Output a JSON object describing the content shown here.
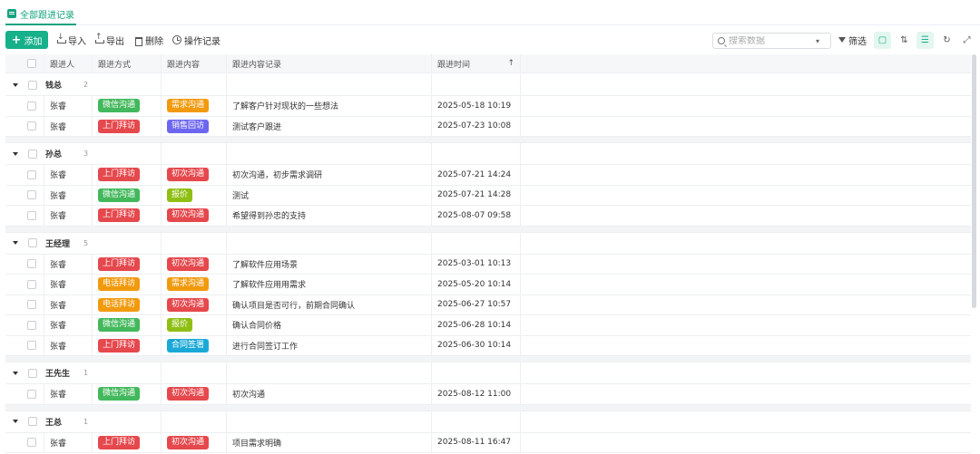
{
  "tab": {
    "label": "全部跟进记录"
  },
  "toolbar": {
    "add_label": "添加",
    "import_label": "导入",
    "export_label": "导出",
    "delete_label": "删除",
    "oplog_label": "操作记录",
    "search_placeholder": "搜索数据",
    "filter_label": "筛选"
  },
  "columns": [
    "跟进人",
    "跟进方式",
    "跟进内容",
    "跟进内容记录",
    "跟进时间"
  ],
  "sort_indicator": "↑",
  "tag_colors": {
    "微信沟通": "#43b85c",
    "上门拜访": "#e5484d",
    "电话拜访": "#f29a0e",
    "需求沟通": "#f29a0e",
    "销售回访": "#6d66f0",
    "初次沟通": "#e5484d",
    "报价": "#8fbf14",
    "合同签署": "#1aa8d6"
  },
  "groups": [
    {
      "name": "钱总",
      "count": "2",
      "rows": [
        {
          "person": "张睿",
          "method": "微信沟通",
          "content": "需求沟通",
          "record": "了解客户针对现状的一些想法",
          "time": "2025-05-18 10:19"
        },
        {
          "person": "张睿",
          "method": "上门拜访",
          "content": "销售回访",
          "record": "测试客户跟进",
          "time": "2025-07-23 10:08"
        }
      ]
    },
    {
      "name": "孙总",
      "count": "3",
      "rows": [
        {
          "person": "张睿",
          "method": "上门拜访",
          "content": "初次沟通",
          "record": "初次沟通，初步需求调研",
          "time": "2025-07-21 14:24"
        },
        {
          "person": "张睿",
          "method": "微信沟通",
          "content": "报价",
          "record": "测试",
          "time": "2025-07-21 14:28"
        },
        {
          "person": "张睿",
          "method": "上门拜访",
          "content": "初次沟通",
          "record": "希望得到孙忠的支持",
          "time": "2025-08-07 09:58"
        }
      ]
    },
    {
      "name": "王经理",
      "count": "5",
      "rows": [
        {
          "person": "张睿",
          "method": "上门拜访",
          "content": "初次沟通",
          "record": "了解软件应用场景",
          "time": "2025-03-01 10:13"
        },
        {
          "person": "张睿",
          "method": "电话拜访",
          "content": "需求沟通",
          "record": "了解软件应用用需求",
          "time": "2025-05-20 10:14"
        },
        {
          "person": "张睿",
          "method": "电话拜访",
          "content": "初次沟通",
          "record": "确认项目是否可行，前期合同确认",
          "time": "2025-06-27 10:57"
        },
        {
          "person": "张睿",
          "method": "微信沟通",
          "content": "报价",
          "record": "确认合同价格",
          "time": "2025-06-28 10:14"
        },
        {
          "person": "张睿",
          "method": "上门拜访",
          "content": "合同签署",
          "record": "进行合同签订工作",
          "time": "2025-06-30 10:14"
        }
      ]
    },
    {
      "name": "王先生",
      "count": "1",
      "rows": [
        {
          "person": "张睿",
          "method": "微信沟通",
          "content": "初次沟通",
          "record": "初次沟通",
          "time": "2025-08-12 11:00"
        }
      ]
    },
    {
      "name": "王总",
      "count": "1",
      "rows": [
        {
          "person": "张睿",
          "method": "上门拜访",
          "content": "初次沟通",
          "record": "项目需求明确",
          "time": "2025-08-11 16:47"
        }
      ]
    }
  ]
}
